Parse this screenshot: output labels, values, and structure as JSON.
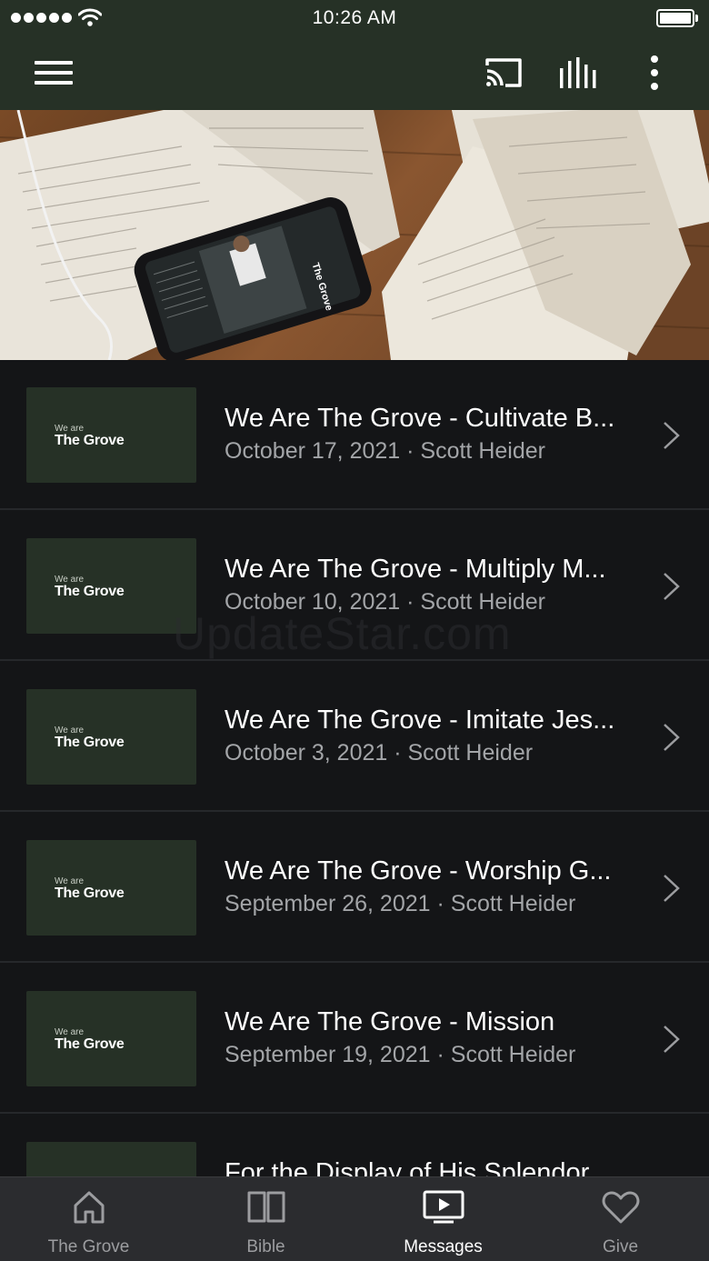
{
  "status_bar": {
    "time": "10:26 AM"
  },
  "app_bar": {
    "menu_icon": "hamburger-menu-icon",
    "cast_icon": "cast-icon",
    "audio_icon": "audio-bars-icon",
    "more_icon": "more-vertical-icon"
  },
  "hero": {
    "image": "open bibles and phone on wooden table",
    "phone_label": "The Grove"
  },
  "sermons": [
    {
      "thumb_small": "We are",
      "thumb_big": "The Grove",
      "title": "We Are The Grove - Cultivate B...",
      "subtitle": "October 17, 2021 · Scott Heider"
    },
    {
      "thumb_small": "We are",
      "thumb_big": "The Grove",
      "title": "We Are The Grove - Multiply M...",
      "subtitle": "October 10, 2021 · Scott Heider"
    },
    {
      "thumb_small": "We are",
      "thumb_big": "The Grove",
      "title": "We Are The Grove - Imitate Jes...",
      "subtitle": "October 3, 2021 · Scott Heider"
    },
    {
      "thumb_small": "We are",
      "thumb_big": "The Grove",
      "title": "We Are The Grove - Worship G...",
      "subtitle": "September 26, 2021 · Scott Heider"
    },
    {
      "thumb_small": "We are",
      "thumb_big": "The Grove",
      "title": "We Are The Grove - Mission",
      "subtitle": "September 19, 2021 · Scott Heider"
    },
    {
      "thumb_small": "",
      "thumb_big": "",
      "title": "For the Display of His Splendor",
      "subtitle": ""
    }
  ],
  "watermark": "UpdateStar.com",
  "tabs": [
    {
      "label": "The Grove",
      "icon": "home-icon",
      "active": false
    },
    {
      "label": "Bible",
      "icon": "book-icon",
      "active": false
    },
    {
      "label": "Messages",
      "icon": "tv-play-icon",
      "active": true
    },
    {
      "label": "Give",
      "icon": "heart-icon",
      "active": false
    }
  ],
  "colors": {
    "header_bg": "#263126",
    "list_bg": "#141517",
    "tab_bar_bg": "#2b2c2f",
    "thumb_bg": "#263126",
    "subtitle_text": "#a3a5a8",
    "inactive_tab": "#9c9da0"
  }
}
